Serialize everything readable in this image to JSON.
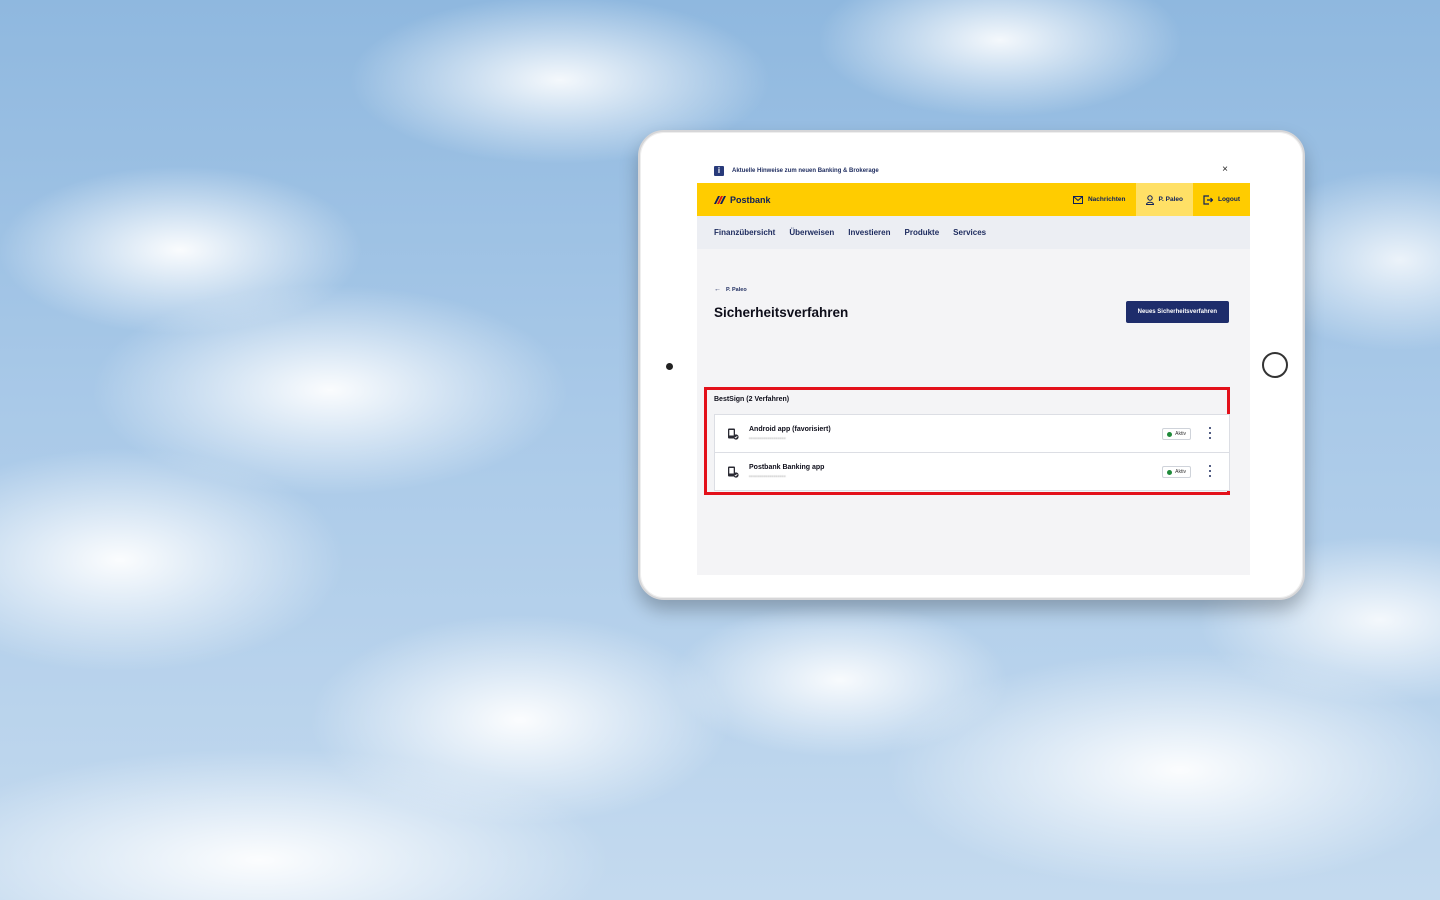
{
  "notice": {
    "text": "Aktuelle Hinweise zum neuen Banking & Brokerage",
    "close_symbol": "×"
  },
  "header": {
    "brand": "Postbank",
    "messages_label": "Nachrichten",
    "user_label": "P. Paleo",
    "logout_label": "Logout",
    "colors": {
      "brand_yellow": "#ffcc00",
      "brand_navy": "#1e2d6b"
    }
  },
  "nav": {
    "items": [
      "Finanzübersicht",
      "Überweisen",
      "Investieren",
      "Produkte",
      "Services"
    ]
  },
  "page": {
    "back_label": "P. Paleo",
    "title": "Sicherheitsverfahren",
    "new_button": "Neues Sicherheitsverfahren"
  },
  "bestsign": {
    "section_label": "BestSign (2 Verfahren)",
    "items": [
      {
        "title": "Android app (favorisiert)",
        "subtitle": "••••••••••••••••••",
        "status": "Aktiv"
      },
      {
        "title": "Postbank Banking app",
        "subtitle": "••••••••••••••••••",
        "status": "Aktiv"
      }
    ]
  }
}
